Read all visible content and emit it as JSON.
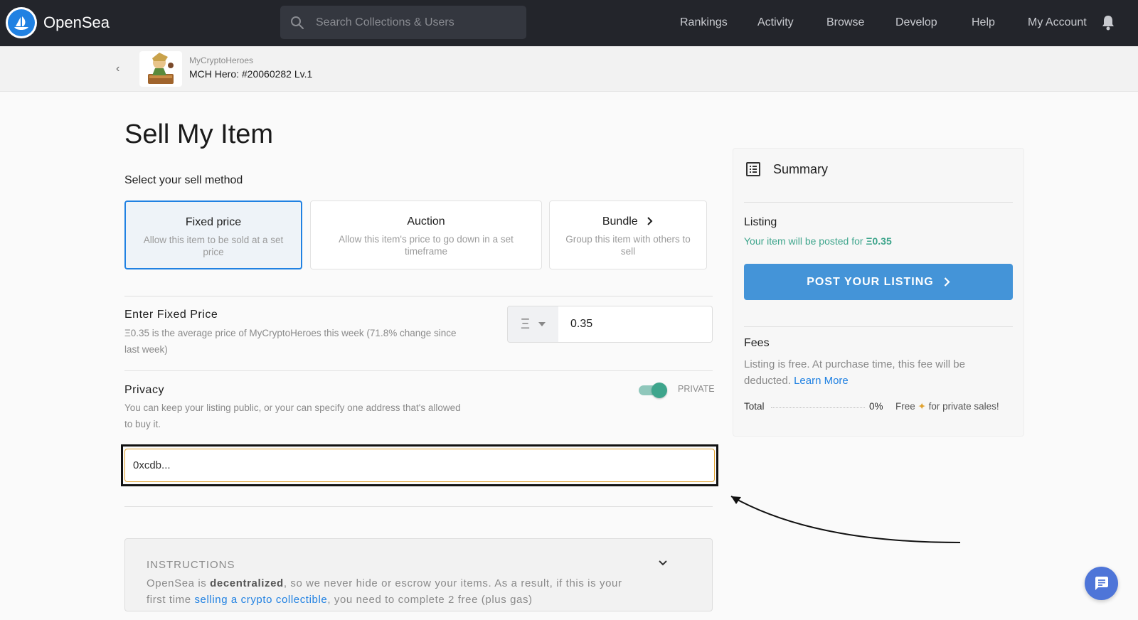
{
  "navbar": {
    "brand": "OpenSea",
    "search_placeholder": "Search Collections & Users",
    "links": [
      "Rankings",
      "Activity",
      "Browse",
      "Develop",
      "Help",
      "My Account"
    ]
  },
  "breadcrumb": {
    "collection": "MyCryptoHeroes",
    "item": "MCH Hero: #20060282 Lv.1"
  },
  "page": {
    "title": "Sell My Item",
    "sell_method_label": "Select your sell method",
    "methods": [
      {
        "title": "Fixed price",
        "desc": "Allow this item to be sold at a set price"
      },
      {
        "title": "Auction",
        "desc": "Allow this item's price to go down in a set timeframe"
      },
      {
        "title": "Bundle",
        "desc": "Group this item with others to sell"
      }
    ],
    "fixed_price": {
      "title": "Enter Fixed Price",
      "desc": "Ξ0.35 is the average price of MyCryptoHeroes this week (71.8% change since last week)",
      "currency_symbol": "Ξ",
      "value": "0.35"
    },
    "privacy": {
      "title": "Privacy",
      "desc": "You can keep your listing public, or your can specify one address that's allowed to buy it.",
      "toggle_label": "PRIVATE",
      "toggle_on": true,
      "address_value": "0xcdb..."
    },
    "instructions": {
      "title": "INSTRUCTIONS",
      "text_1": "OpenSea is ",
      "text_bold": "decentralized",
      "text_2": ", so we never hide or escrow your items. As a result, if this is your first time ",
      "text_link": "selling a crypto collectible",
      "text_3": ", you need to complete 2 free (plus gas)"
    }
  },
  "summary": {
    "title": "Summary",
    "listing_label": "Listing",
    "listing_text": "Your item will be posted for ",
    "listing_price": "Ξ0.35",
    "post_button": "POST YOUR LISTING",
    "fees_label": "Fees",
    "fees_desc": "Listing is free. At purchase time, this fee will be deducted. ",
    "learn_more": "Learn More",
    "total_label": "Total",
    "total_pct": "0%",
    "total_free_1": "Free",
    "total_free_2": "for private sales!"
  },
  "colors": {
    "accent": "#2081e2",
    "navbar": "#23252b",
    "button": "#4494d8",
    "success": "#3ea58c",
    "address_border": "#e0a22f"
  },
  "icons": [
    "opensea-logo-icon",
    "search-icon",
    "bell-icon",
    "back-chevron-icon",
    "chevron-right-icon",
    "chevron-down-icon",
    "summary-list-icon",
    "party-icon",
    "chat-icon",
    "annotation-arrow"
  ]
}
